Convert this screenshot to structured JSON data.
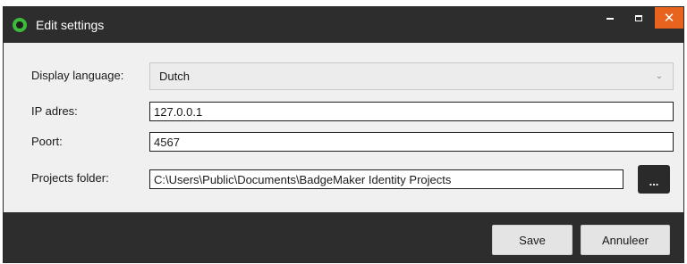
{
  "window": {
    "title": "Edit settings",
    "controls": {
      "minimize": "minimize-icon",
      "maximize": "maximize-icon",
      "close": "close-icon"
    }
  },
  "form": {
    "display_language": {
      "label": "Display language:",
      "value": "Dutch"
    },
    "ip": {
      "label": "IP adres:",
      "value": "127.0.0.1"
    },
    "port": {
      "label": "Poort:",
      "value": "4567"
    },
    "projects_folder": {
      "label": "Projects folder:",
      "value": "C:\\Users\\Public\\Documents\\BadgeMaker Identity Projects",
      "browse_label": "..."
    }
  },
  "footer": {
    "save_label": "Save",
    "cancel_label": "Annuleer"
  },
  "colors": {
    "titlebar": "#2d2d2d",
    "close_button": "#e8641e",
    "logo_ring": "#3dbb3a",
    "form_background": "#f0f0f0"
  }
}
